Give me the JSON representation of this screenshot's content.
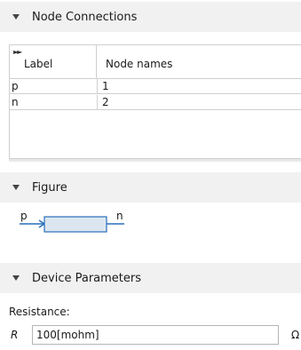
{
  "sections": {
    "node_connections": {
      "title": "Node Connections"
    },
    "figure": {
      "title": "Figure"
    },
    "device_parameters": {
      "title": "Device Parameters"
    }
  },
  "node_table": {
    "headers": {
      "label": "Label",
      "node_names": "Node names"
    },
    "rows": [
      {
        "label": "p",
        "node_name": "1"
      },
      {
        "label": "n",
        "node_name": "2"
      }
    ]
  },
  "figure": {
    "left_terminal": "p",
    "right_terminal": "n",
    "colors": {
      "wire": "#2a6ebb",
      "box_fill": "#dce6f0",
      "box_stroke": "#2a6ebb"
    }
  },
  "device_parameters": {
    "resistance_label": "Resistance:",
    "symbol": "R",
    "value": "100[mohm]",
    "unit": "Ω"
  },
  "icons": {
    "section_toggle": "chevron-down-icon",
    "table_expand": "expand-columns-icon"
  }
}
